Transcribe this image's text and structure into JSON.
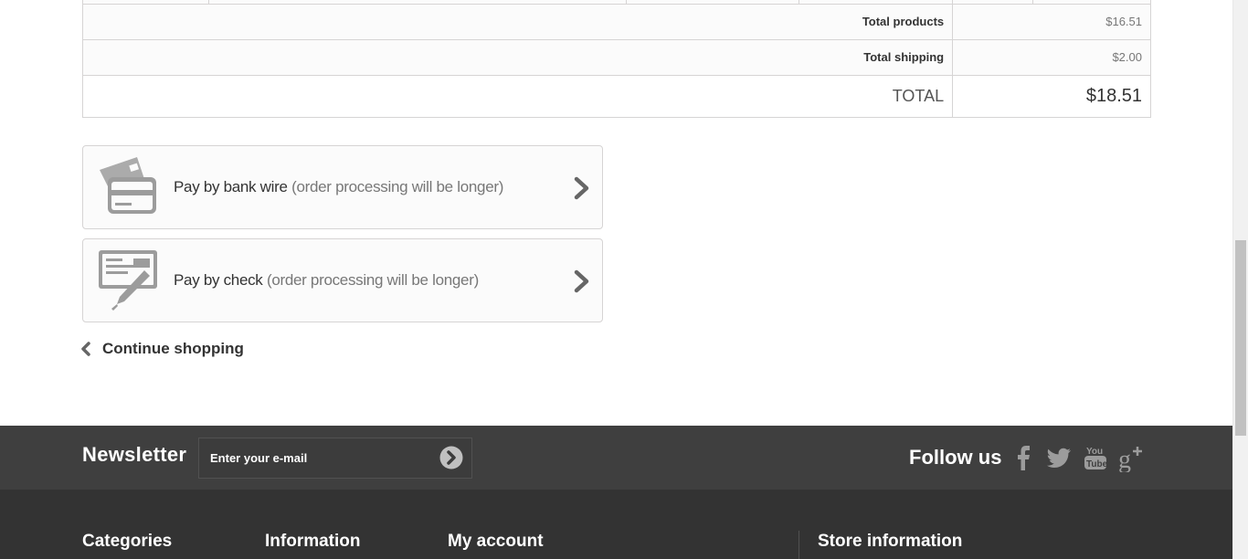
{
  "summary": {
    "total_products_label": "Total products",
    "total_products_value": "$16.51",
    "total_shipping_label": "Total shipping",
    "total_shipping_value": "$2.00",
    "total_label": "TOTAL",
    "total_value": "$18.51"
  },
  "payments": [
    {
      "icon": "bank-card-icon",
      "title": "Pay by bank wire",
      "note": "(order processing will be longer)"
    },
    {
      "icon": "check-pen-icon",
      "title": "Pay by check",
      "note": "(order processing will be longer)"
    }
  ],
  "continue_shopping": "Continue shopping",
  "newsletter": {
    "title": "Newsletter",
    "placeholder": "Enter your e-mail"
  },
  "follow": {
    "title": "Follow us",
    "networks": [
      "facebook-icon",
      "twitter-icon",
      "youtube-icon",
      "google-plus-icon"
    ]
  },
  "footer_columns": [
    "Categories",
    "Information",
    "My account",
    "Store information"
  ],
  "colors": {
    "footer_top": "#3f3f3f",
    "footer_bottom": "#333333",
    "icon_gray": "#9c9c9c"
  }
}
